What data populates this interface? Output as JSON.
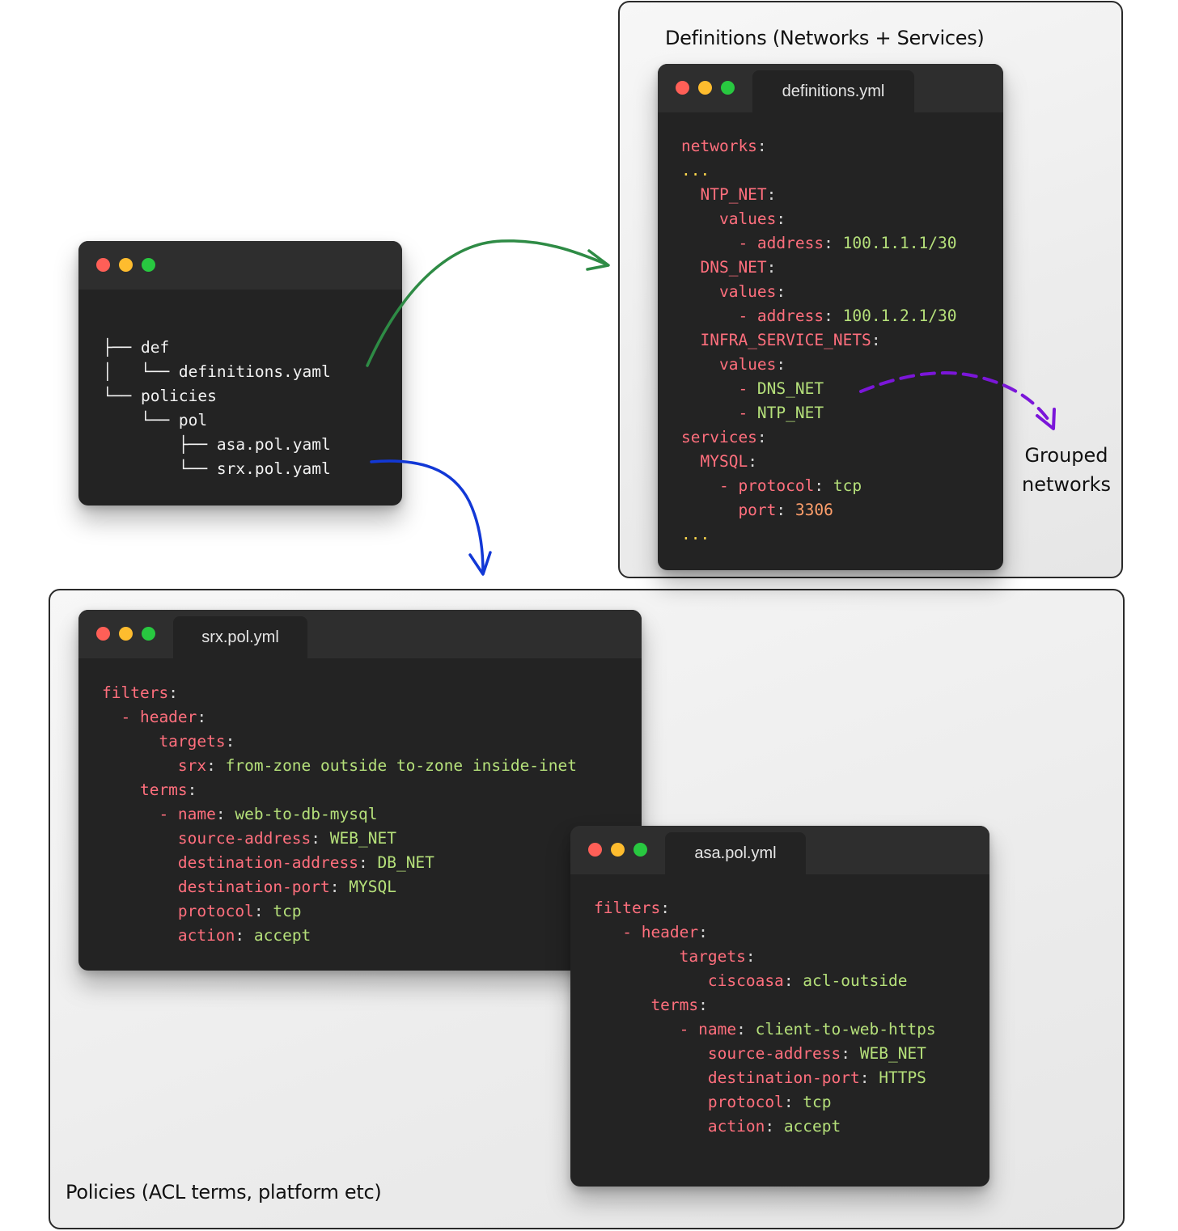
{
  "definitions_panel": {
    "title": "Definitions (Networks + Services)"
  },
  "policies_panel": {
    "title": "Policies (ACL terms, platform etc)"
  },
  "tree_window": {
    "lines": [
      [
        {
          "c": "t",
          "s": "├── def"
        }
      ],
      [
        {
          "c": "t",
          "s": "│   └── definitions.yaml"
        }
      ],
      [
        {
          "c": "t",
          "s": "└── policies"
        }
      ],
      [
        {
          "c": "t",
          "s": "    └── pol"
        }
      ],
      [
        {
          "c": "t",
          "s": "        ├── asa.pol.yaml"
        }
      ],
      [
        {
          "c": "t",
          "s": "        └── srx.pol.yaml"
        }
      ]
    ]
  },
  "definitions_window": {
    "tab": "definitions.yml",
    "lines": [
      [
        {
          "c": "k",
          "s": "networks"
        },
        {
          "c": "p",
          "s": ":"
        }
      ],
      [
        {
          "c": "d",
          "s": "..."
        }
      ],
      [
        {
          "c": "k",
          "s": "  NTP_NET"
        },
        {
          "c": "p",
          "s": ":"
        }
      ],
      [
        {
          "c": "k",
          "s": "    values"
        },
        {
          "c": "p",
          "s": ":"
        }
      ],
      [
        {
          "c": "k",
          "s": "      - address"
        },
        {
          "c": "p",
          "s": ": "
        },
        {
          "c": "v",
          "s": "100.1.1.1/30"
        }
      ],
      [
        {
          "c": "k",
          "s": "  DNS_NET"
        },
        {
          "c": "p",
          "s": ":"
        }
      ],
      [
        {
          "c": "k",
          "s": "    values"
        },
        {
          "c": "p",
          "s": ":"
        }
      ],
      [
        {
          "c": "k",
          "s": "      - address"
        },
        {
          "c": "p",
          "s": ": "
        },
        {
          "c": "v",
          "s": "100.1.2.1/30"
        }
      ],
      [
        {
          "c": "k",
          "s": "  INFRA_SERVICE_NETS"
        },
        {
          "c": "p",
          "s": ":"
        }
      ],
      [
        {
          "c": "k",
          "s": "    values"
        },
        {
          "c": "p",
          "s": ":"
        }
      ],
      [
        {
          "c": "k",
          "s": "      - "
        },
        {
          "c": "v",
          "s": "DNS_NET"
        }
      ],
      [
        {
          "c": "k",
          "s": "      - "
        },
        {
          "c": "v",
          "s": "NTP_NET"
        }
      ],
      [
        {
          "c": "k",
          "s": "services"
        },
        {
          "c": "p",
          "s": ":"
        }
      ],
      [
        {
          "c": "k",
          "s": "  MYSQL"
        },
        {
          "c": "p",
          "s": ":"
        }
      ],
      [
        {
          "c": "k",
          "s": "    - protocol"
        },
        {
          "c": "p",
          "s": ": "
        },
        {
          "c": "v",
          "s": "tcp"
        }
      ],
      [
        {
          "c": "k",
          "s": "      port"
        },
        {
          "c": "p",
          "s": ": "
        },
        {
          "c": "n",
          "s": "3306"
        }
      ],
      [
        {
          "c": "d",
          "s": "..."
        }
      ]
    ]
  },
  "srx_window": {
    "tab": "srx.pol.yml",
    "lines": [
      [
        {
          "c": "k",
          "s": "filters"
        },
        {
          "c": "p",
          "s": ":"
        }
      ],
      [
        {
          "c": "k",
          "s": "  - header"
        },
        {
          "c": "p",
          "s": ":"
        }
      ],
      [
        {
          "c": "k",
          "s": "      targets"
        },
        {
          "c": "p",
          "s": ":"
        }
      ],
      [
        {
          "c": "k",
          "s": "        srx"
        },
        {
          "c": "p",
          "s": ": "
        },
        {
          "c": "v",
          "s": "from-zone outside to-zone inside-inet"
        }
      ],
      [
        {
          "c": "k",
          "s": "    terms"
        },
        {
          "c": "p",
          "s": ":"
        }
      ],
      [
        {
          "c": "k",
          "s": "      - name"
        },
        {
          "c": "p",
          "s": ": "
        },
        {
          "c": "v",
          "s": "web-to-db-mysql"
        }
      ],
      [
        {
          "c": "k",
          "s": "        source-address"
        },
        {
          "c": "p",
          "s": ": "
        },
        {
          "c": "v",
          "s": "WEB_NET"
        }
      ],
      [
        {
          "c": "k",
          "s": "        destination-address"
        },
        {
          "c": "p",
          "s": ": "
        },
        {
          "c": "v",
          "s": "DB_NET"
        }
      ],
      [
        {
          "c": "k",
          "s": "        destination-port"
        },
        {
          "c": "p",
          "s": ": "
        },
        {
          "c": "v",
          "s": "MYSQL"
        }
      ],
      [
        {
          "c": "k",
          "s": "        protocol"
        },
        {
          "c": "p",
          "s": ": "
        },
        {
          "c": "v",
          "s": "tcp"
        }
      ],
      [
        {
          "c": "k",
          "s": "        action"
        },
        {
          "c": "p",
          "s": ": "
        },
        {
          "c": "v",
          "s": "accept"
        }
      ]
    ]
  },
  "asa_window": {
    "tab": "asa.pol.yml",
    "lines": [
      [
        {
          "c": "k",
          "s": "filters"
        },
        {
          "c": "p",
          "s": ":"
        }
      ],
      [
        {
          "c": "k",
          "s": "   - header"
        },
        {
          "c": "p",
          "s": ":"
        }
      ],
      [
        {
          "c": "k",
          "s": "         targets"
        },
        {
          "c": "p",
          "s": ":"
        }
      ],
      [
        {
          "c": "k",
          "s": "            ciscoasa"
        },
        {
          "c": "p",
          "s": ": "
        },
        {
          "c": "v",
          "s": "acl-outside"
        }
      ],
      [
        {
          "c": "k",
          "s": "      terms"
        },
        {
          "c": "p",
          "s": ":"
        }
      ],
      [
        {
          "c": "k",
          "s": "         - name"
        },
        {
          "c": "p",
          "s": ": "
        },
        {
          "c": "v",
          "s": "client-to-web-https"
        }
      ],
      [
        {
          "c": "k",
          "s": "            source-address"
        },
        {
          "c": "p",
          "s": ": "
        },
        {
          "c": "v",
          "s": "WEB_NET"
        }
      ],
      [
        {
          "c": "k",
          "s": "            destination-port"
        },
        {
          "c": "p",
          "s": ": "
        },
        {
          "c": "v",
          "s": "HTTPS"
        }
      ],
      [
        {
          "c": "k",
          "s": "            protocol"
        },
        {
          "c": "p",
          "s": ": "
        },
        {
          "c": "v",
          "s": "tcp"
        }
      ],
      [
        {
          "c": "k",
          "s": "            action"
        },
        {
          "c": "p",
          "s": ": "
        },
        {
          "c": "v",
          "s": "accept"
        }
      ]
    ]
  },
  "annotation": {
    "line1": "Grouped",
    "line2": "networks"
  },
  "colors": {
    "key": "#ff6f7d",
    "value": "#b5e07a",
    "number": "#ff9f6b",
    "ellipsis": "#ffd84d",
    "arrow_definitions": "#2e8b45",
    "arrow_policies": "#1238d6",
    "arrow_grouped": "#7b16d9"
  }
}
